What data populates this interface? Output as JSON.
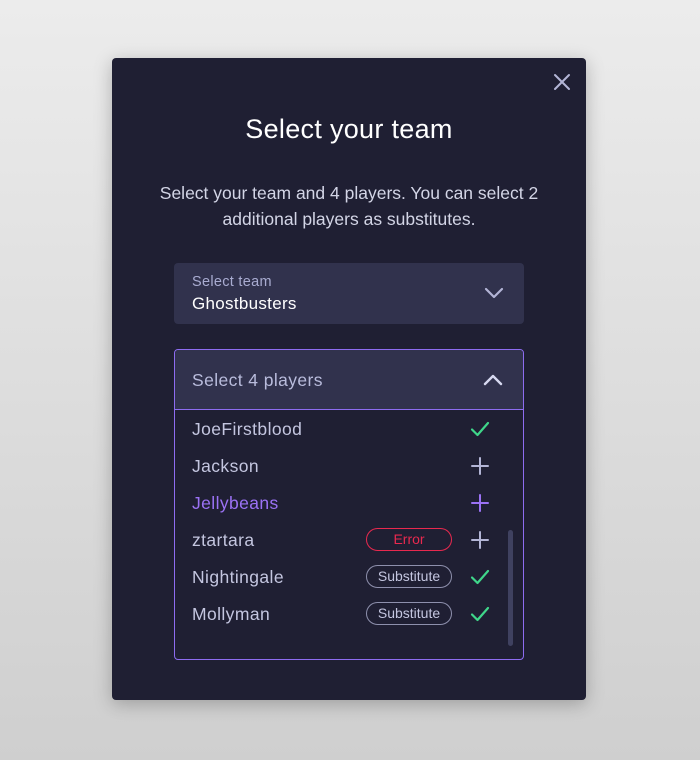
{
  "dialog": {
    "title": "Select your team",
    "subtitle": "Select your team and 4 players. You can select 2 additional players as substitutes."
  },
  "team_select": {
    "label": "Select team",
    "value": "Ghostbusters"
  },
  "players_select": {
    "label": "Select 4 players",
    "players": [
      {
        "name": "JoeFirstblood",
        "badge": "",
        "state": "selected",
        "icon": "check-icon"
      },
      {
        "name": "Jackson",
        "badge": "",
        "state": "unselected",
        "icon": "plus-icon"
      },
      {
        "name": "Jellybeans",
        "badge": "",
        "state": "hover",
        "icon": "plus-icon"
      },
      {
        "name": "ztartara",
        "badge": "Error",
        "state": "error",
        "icon": "plus-icon"
      },
      {
        "name": "Nightingale",
        "badge": "Substitute",
        "state": "selected",
        "icon": "check-icon"
      },
      {
        "name": "Mollyman",
        "badge": "Substitute",
        "state": "selected",
        "icon": "check-icon"
      }
    ]
  },
  "colors": {
    "accent": "#8d6cf0",
    "highlight_text": "#9b72f5",
    "check": "#3fd68a",
    "error": "#e8294f",
    "modal_bg": "#1f1f33",
    "field_bg": "#31324d"
  }
}
